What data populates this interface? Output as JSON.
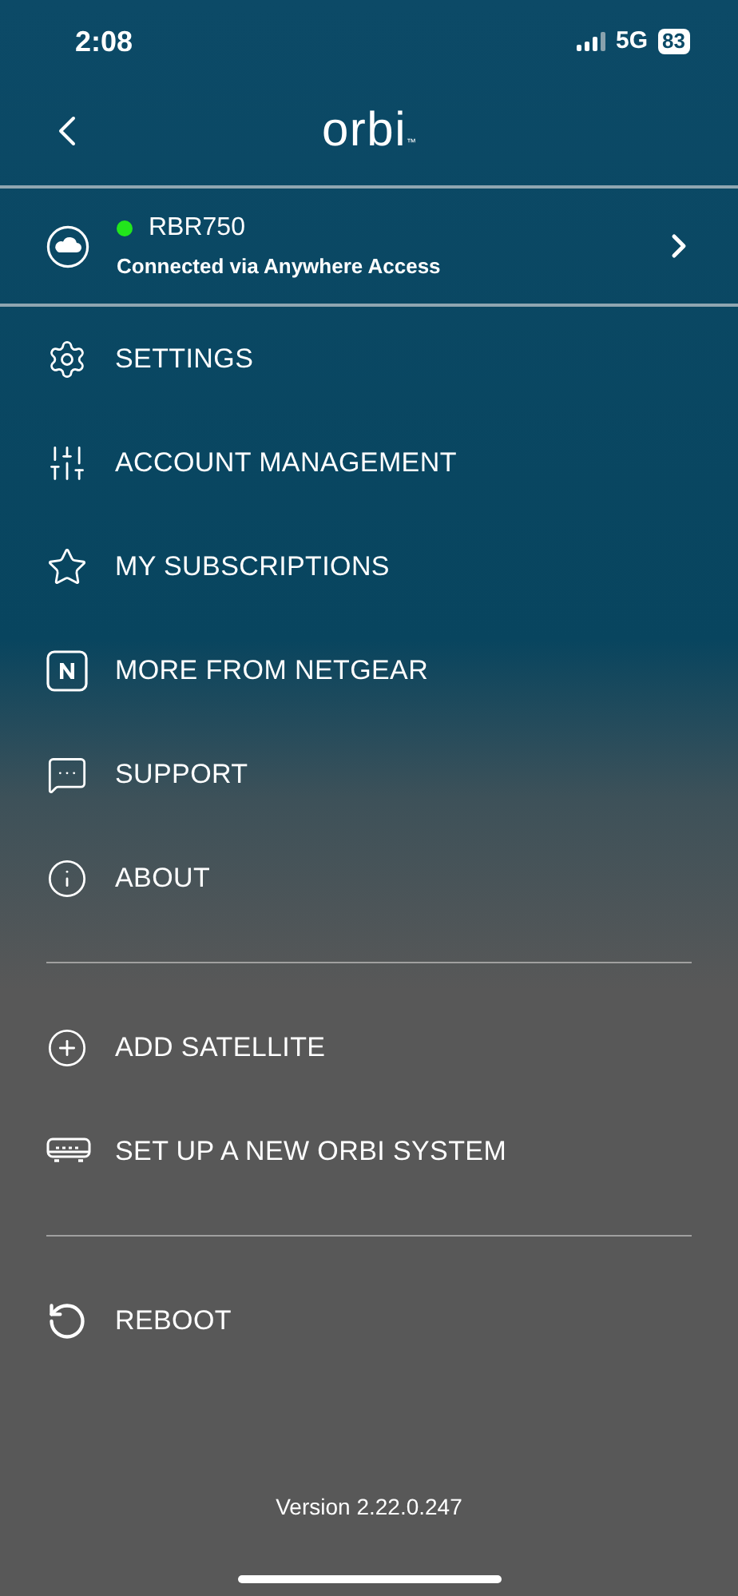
{
  "status_bar": {
    "time": "2:08",
    "network": "5G",
    "battery": "83"
  },
  "header": {
    "logo": "orbi",
    "logo_mark": "™"
  },
  "device": {
    "name": "RBR750",
    "online": true,
    "subtitle": "Connected via Anywhere Access"
  },
  "menu_groups": [
    {
      "items": [
        {
          "kind": "settings",
          "label": "SETTINGS"
        },
        {
          "kind": "sliders",
          "label": "ACCOUNT MANAGEMENT"
        },
        {
          "kind": "star",
          "label": "MY SUBSCRIPTIONS"
        },
        {
          "kind": "netgear",
          "label": "MORE FROM NETGEAR"
        },
        {
          "kind": "chat",
          "label": "SUPPORT"
        },
        {
          "kind": "info",
          "label": "ABOUT"
        }
      ]
    },
    {
      "items": [
        {
          "kind": "plus",
          "label": "ADD SATELLITE"
        },
        {
          "kind": "router",
          "label": "SET UP A NEW ORBI SYSTEM"
        }
      ]
    },
    {
      "items": [
        {
          "kind": "reboot",
          "label": "REBOOT"
        }
      ]
    }
  ],
  "version": "Version 2.22.0.247"
}
